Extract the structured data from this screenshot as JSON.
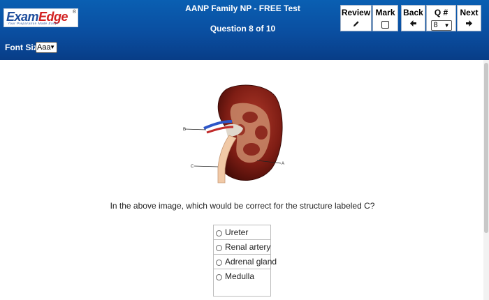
{
  "header": {
    "logo": {
      "brand_e": "Ex",
      "brand_am": "am",
      "brand_edge": "Edge",
      "tagline": "Your Preparation Made Easy!",
      "registered": "®"
    },
    "test_title": "AANP Family NP - FREE Test",
    "question_counter": "Question 8 of 10",
    "font_size_label": "Font Size",
    "font_size_value": "Aaa",
    "buttons": {
      "review": {
        "label": "Review",
        "icon": "pencil-icon"
      },
      "mark": {
        "label": "Mark",
        "icon": "checkbox-icon"
      },
      "back": {
        "label": "Back",
        "icon": "arrow-left-icon"
      },
      "qnum": {
        "label": "Q #",
        "value": "8"
      },
      "next": {
        "label": "Next",
        "icon": "arrow-right-icon"
      }
    }
  },
  "question": {
    "image": {
      "labels": {
        "a": "A",
        "b": "B",
        "c": "C"
      }
    },
    "text": "In the above image, which would be correct for the structure labeled C?",
    "options": [
      "Ureter",
      "Renal artery",
      "Adrenal gland",
      "Medulla"
    ]
  },
  "colors": {
    "header_top": "#0a5fb2",
    "header_bottom": "#083d87",
    "brand_red": "#d21f1f",
    "brand_blue": "#1f4e9c"
  }
}
